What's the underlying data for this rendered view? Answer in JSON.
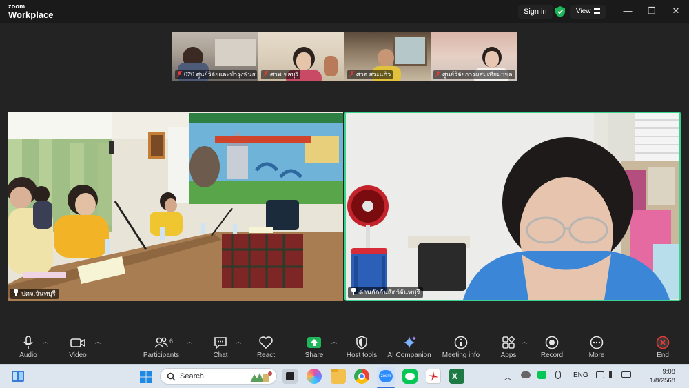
{
  "app": {
    "brand_small": "zoom",
    "brand_big": "Workplace"
  },
  "titlebar": {
    "signin_label": "Sign in",
    "view_label": "View",
    "min": "—",
    "restore": "❐",
    "close": "✕"
  },
  "thumbnails": [
    {
      "label": "020 ศูนย์วิจัยและบำรุงพันธ…",
      "muted": true
    },
    {
      "label": "ศวพ.ชลบุรี",
      "muted": true
    },
    {
      "label": "ศวอ.สระแก้ว",
      "muted": true
    },
    {
      "label": "ศูนย์วิจัยการผสมเทียมฯชล…",
      "muted": true
    }
  ],
  "main_tiles": [
    {
      "label": "ปศจ.จันทบุรี",
      "pinned": true,
      "banner_text": "สำนักงานปศุสัตว์จังหวัดจันทบุรี",
      "banner_text2": "จันทบุรี",
      "placard": "ปศุสัตว์อำเภอ"
    },
    {
      "label": "ด่านกักกันสัตว์จันทบุรี",
      "pinned": true,
      "active_speaker": true
    }
  ],
  "toolbar": {
    "items": [
      {
        "id": "audio",
        "label": "Audio",
        "icon": "microphone-icon"
      },
      {
        "id": "video",
        "label": "Video",
        "icon": "camera-icon"
      },
      {
        "id": "participants",
        "label": "Participants",
        "icon": "people-icon",
        "count": "6"
      },
      {
        "id": "chat",
        "label": "Chat",
        "icon": "chat-icon"
      },
      {
        "id": "react",
        "label": "React",
        "icon": "heart-icon"
      },
      {
        "id": "share",
        "label": "Share",
        "icon": "share-icon"
      },
      {
        "id": "host_tools",
        "label": "Host tools",
        "icon": "shield-icon"
      },
      {
        "id": "ai",
        "label": "AI Companion",
        "icon": "sparkle-icon"
      },
      {
        "id": "info",
        "label": "Meeting info",
        "icon": "info-icon"
      },
      {
        "id": "apps",
        "label": "Apps",
        "icon": "apps-icon"
      },
      {
        "id": "record",
        "label": "Record",
        "icon": "record-icon"
      },
      {
        "id": "more",
        "label": "More",
        "icon": "more-icon"
      },
      {
        "id": "end",
        "label": "End",
        "icon": "end-icon"
      }
    ]
  },
  "taskbar": {
    "search_label": "Search",
    "language": "ENG",
    "time": "9:08",
    "date": "1/8/2568"
  },
  "colors": {
    "accent_green": "#3bd18f",
    "share_green": "#1fb55a",
    "end_red": "#e53935"
  }
}
